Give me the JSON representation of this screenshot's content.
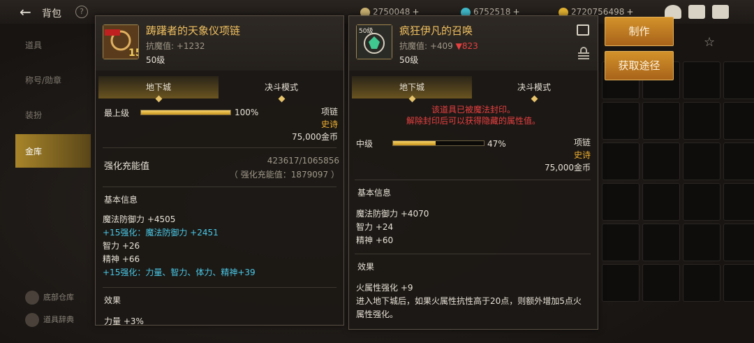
{
  "topbar": {
    "title": "背包",
    "help": "?",
    "currencies": [
      {
        "value": "2750048",
        "color": "#c9b070"
      },
      {
        "value": "6752518",
        "color": "#3fb8c8"
      },
      {
        "value": "2720756498",
        "color": "#e0b030"
      }
    ],
    "plus": "+"
  },
  "sidebar": {
    "items": [
      "道具",
      "称号/勋章",
      "装扮",
      "金库"
    ],
    "bottom": [
      "底部仓库",
      "道具辞典"
    ]
  },
  "left_item": {
    "name": "踌躇者的天象仪项链",
    "stat": "抗魔值: +1232",
    "level": "50级",
    "badge_enhance": "15",
    "tabs": [
      "地下城",
      "决斗模式"
    ],
    "grade": "最上级",
    "grade_percent": 1.0,
    "grade_percent_text": "100%",
    "type": "项链",
    "rarity": "史诗",
    "price": "75,000金币",
    "charge_label": "强化充能值",
    "charge_value": "423617/1065856",
    "charge_sub": "（ 强化充能值：1879097 ）",
    "basic_title": "基本信息",
    "basic": [
      {
        "text": "魔法防御力 +4505",
        "color": "#e8e2d6"
      },
      {
        "text": "+15强化：魔法防御力 +2451",
        "color": "#49c9e8"
      },
      {
        "text": "智力 +26",
        "color": "#e8e2d6"
      },
      {
        "text": "精神 +66",
        "color": "#e8e2d6"
      },
      {
        "text": "+15强化：力量、智力、体力、精神+39",
        "color": "#49c9e8"
      }
    ],
    "effect_title": "效果",
    "effect_first": "力量 +3%"
  },
  "right_item": {
    "name": "疯狂伊凡的召唤",
    "stat": "抗魔值: +409",
    "stat_diff": "▼823",
    "level": "50级",
    "icon_level": "50级",
    "tabs": [
      "地下城",
      "决斗模式"
    ],
    "sealed_lines": [
      "该道具已被魔法封印。",
      "解除封印后可以获得隐藏的属性值。"
    ],
    "grade": "中级",
    "grade_percent": 0.47,
    "grade_percent_text": "47%",
    "type": "项链",
    "rarity": "史诗",
    "price": "75,000金币",
    "basic_title": "基本信息",
    "basic": [
      "魔法防御力 +4070",
      "智力 +24",
      "精神 +60"
    ],
    "effect_title": "效果",
    "effects": [
      "火属性强化 +9",
      "进入地下城后，如果火属性抗性高于20点，则额外增加5点火",
      "属性强化。"
    ]
  },
  "actions": {
    "craft": "制作",
    "obtain": "获取途径"
  }
}
